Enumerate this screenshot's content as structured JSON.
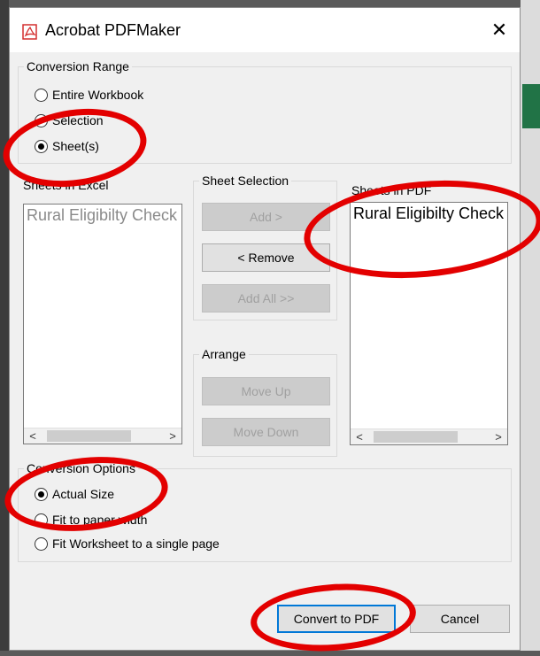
{
  "window": {
    "title": "Acrobat PDFMaker",
    "close_glyph": "✕"
  },
  "conversion_range": {
    "legend": "Conversion Range",
    "options": [
      {
        "label": "Entire Workbook",
        "selected": false
      },
      {
        "label": "Selection",
        "selected": false
      },
      {
        "label": "Sheet(s)",
        "selected": true
      }
    ]
  },
  "sheets_in_excel": {
    "legend": "Sheets in Excel",
    "items": [
      "Rural Eligibilty Check"
    ],
    "scroll_left": "<",
    "scroll_right": ">"
  },
  "sheet_selection": {
    "legend": "Sheet Selection",
    "add_label": "Add >",
    "remove_label": "< Remove",
    "add_all_label": "Add All >>"
  },
  "arrange": {
    "legend": "Arrange",
    "move_up_label": "Move Up",
    "move_down_label": "Move Down"
  },
  "sheets_in_pdf": {
    "legend": "Sheets in PDF",
    "items": [
      "Rural Eligibilty Check"
    ],
    "scroll_left": "<",
    "scroll_right": ">"
  },
  "conversion_options": {
    "legend": "Conversion Options",
    "options": [
      {
        "label": "Actual Size",
        "selected": true
      },
      {
        "label": "Fit to paper width",
        "selected": false
      },
      {
        "label": "Fit Worksheet to a single page",
        "selected": false
      }
    ]
  },
  "footer": {
    "convert_label": "Convert to PDF",
    "cancel_label": "Cancel"
  },
  "colors": {
    "annotation_red": "#e30000",
    "accent_blue": "#0078d7",
    "pdf_red": "#d32f2f"
  }
}
